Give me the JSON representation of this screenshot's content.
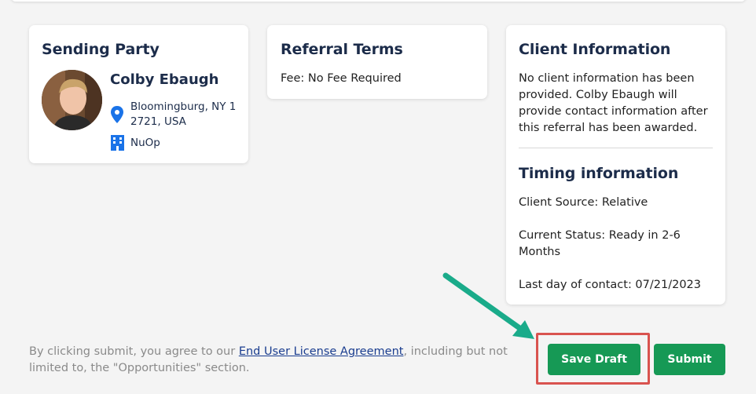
{
  "sending_party": {
    "title": "Sending Party",
    "name": "Colby Ebaugh",
    "location": "Bloomingburg, NY 12721, USA",
    "organization": "NuOp"
  },
  "referral_terms": {
    "title": "Referral Terms",
    "fee": "Fee: No Fee Required"
  },
  "client_info": {
    "title": "Client Information",
    "text": "No client information has been provided. Colby Ebaugh will provide contact information after this referral has been awarded."
  },
  "timing": {
    "title": "Timing information",
    "client_source": "Client Source: Relative",
    "current_status": "Current Status: Ready in 2-6 Months",
    "last_contact": "Last day of contact: 07/21/2023"
  },
  "footer": {
    "before_link": "By clicking submit, you agree to our ",
    "link": "End User License Agreement",
    "after_link": ", including but not limited to, the \"Opportunities\" section."
  },
  "buttons": {
    "save_draft": "Save Draft",
    "submit": "Submit"
  },
  "colors": {
    "button_green": "#169955",
    "heading_navy": "#1c2c4a",
    "location_icon_blue": "#1a73e8",
    "highlight_red": "#d9534f",
    "arrow_teal": "#1aab8a"
  },
  "icons": {
    "location": "map-pin-icon",
    "organization": "building-icon"
  }
}
